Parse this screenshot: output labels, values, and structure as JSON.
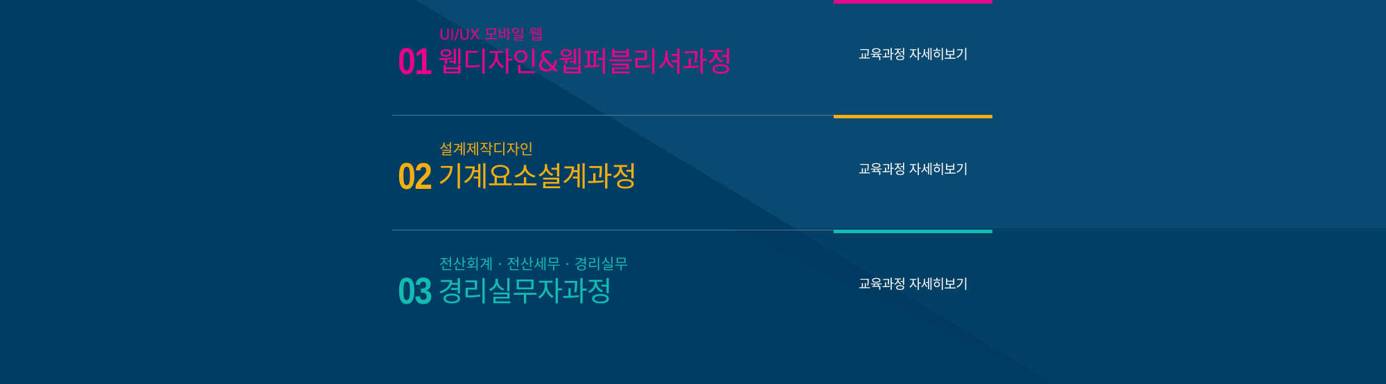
{
  "theme": {
    "background": "#003d65",
    "background_light": "#0a4a72",
    "background_shadow": "#00385c",
    "divider": "#6f93ad",
    "link_text": "#ffffff"
  },
  "courses": [
    {
      "number": "01",
      "subtitle": "UI/UX 모바일 웹",
      "title": "웹디자인&웹퍼블리셔과정",
      "link_label": "교육과정 자세히보기",
      "accent": "#ec008c"
    },
    {
      "number": "02",
      "subtitle": "설계제작디자인",
      "title": "기계요소설계과정",
      "link_label": "교육과정 자세히보기",
      "accent": "#f5ae0f"
    },
    {
      "number": "03",
      "subtitle": "전산회계 · 전산세무 · 경리실무",
      "title": "경리실무자과정",
      "link_label": "교육과정 자세히보기",
      "accent": "#12bcb0"
    }
  ]
}
